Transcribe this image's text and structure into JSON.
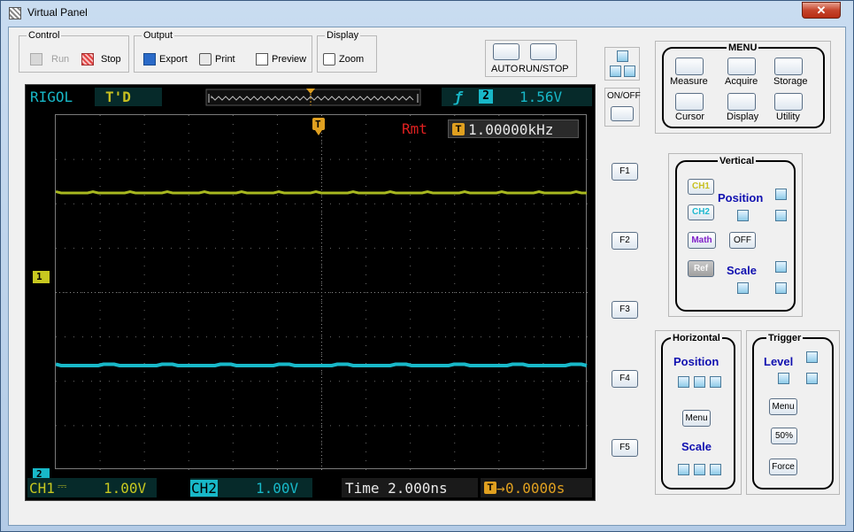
{
  "window": {
    "title": "Virtual Panel",
    "close_label": "✕"
  },
  "toolbar": {
    "control": {
      "legend": "Control",
      "run": "Run",
      "stop": "Stop"
    },
    "output": {
      "legend": "Output",
      "export": "Export",
      "print": "Print",
      "preview": "Preview"
    },
    "display": {
      "legend": "Display",
      "zoom": "Zoom"
    }
  },
  "run_buttons": {
    "auto_label": "AUTO",
    "runstop_label": "RUN/STOP"
  },
  "power": {
    "label": "ON/OFF"
  },
  "menu": {
    "title": "MENU",
    "items": [
      "Measure",
      "Acquire",
      "Storage",
      "Cursor",
      "Display",
      "Utility"
    ]
  },
  "function_keys": [
    "F1",
    "F2",
    "F3",
    "F4",
    "F5"
  ],
  "vertical": {
    "title": "Vertical",
    "ch1": "CH1",
    "ch2": "CH2",
    "math": "Math",
    "ref": "Ref",
    "off": "OFF",
    "position": "Position",
    "scale": "Scale"
  },
  "horizontal": {
    "title": "Horizontal",
    "position": "Position",
    "menu": "Menu",
    "scale": "Scale"
  },
  "trigger": {
    "title": "Trigger",
    "level": "Level",
    "menu": "Menu",
    "fifty": "50%",
    "force": "Force"
  },
  "scope": {
    "brand": "RIGOL",
    "status": "T'D",
    "trigger_info": {
      "edge": "ƒ",
      "channel": "2",
      "level": "1.56V"
    },
    "trigger_marker": "T",
    "remote": "Rmt",
    "frequency": "1.00000kHz",
    "ch1_marker": "1",
    "ch2_marker": "2",
    "bottom": {
      "ch1": "CH1",
      "ch1_scale": "1.00V",
      "ch2": "CH2",
      "ch2_scale": "1.00V",
      "time": "Time 2.000ns",
      "offset": "0.0000s"
    },
    "colors": {
      "ch1": "#a8b820",
      "ch2": "#18b8c8",
      "trigger": "#e0a020",
      "remote": "#e02020"
    }
  }
}
